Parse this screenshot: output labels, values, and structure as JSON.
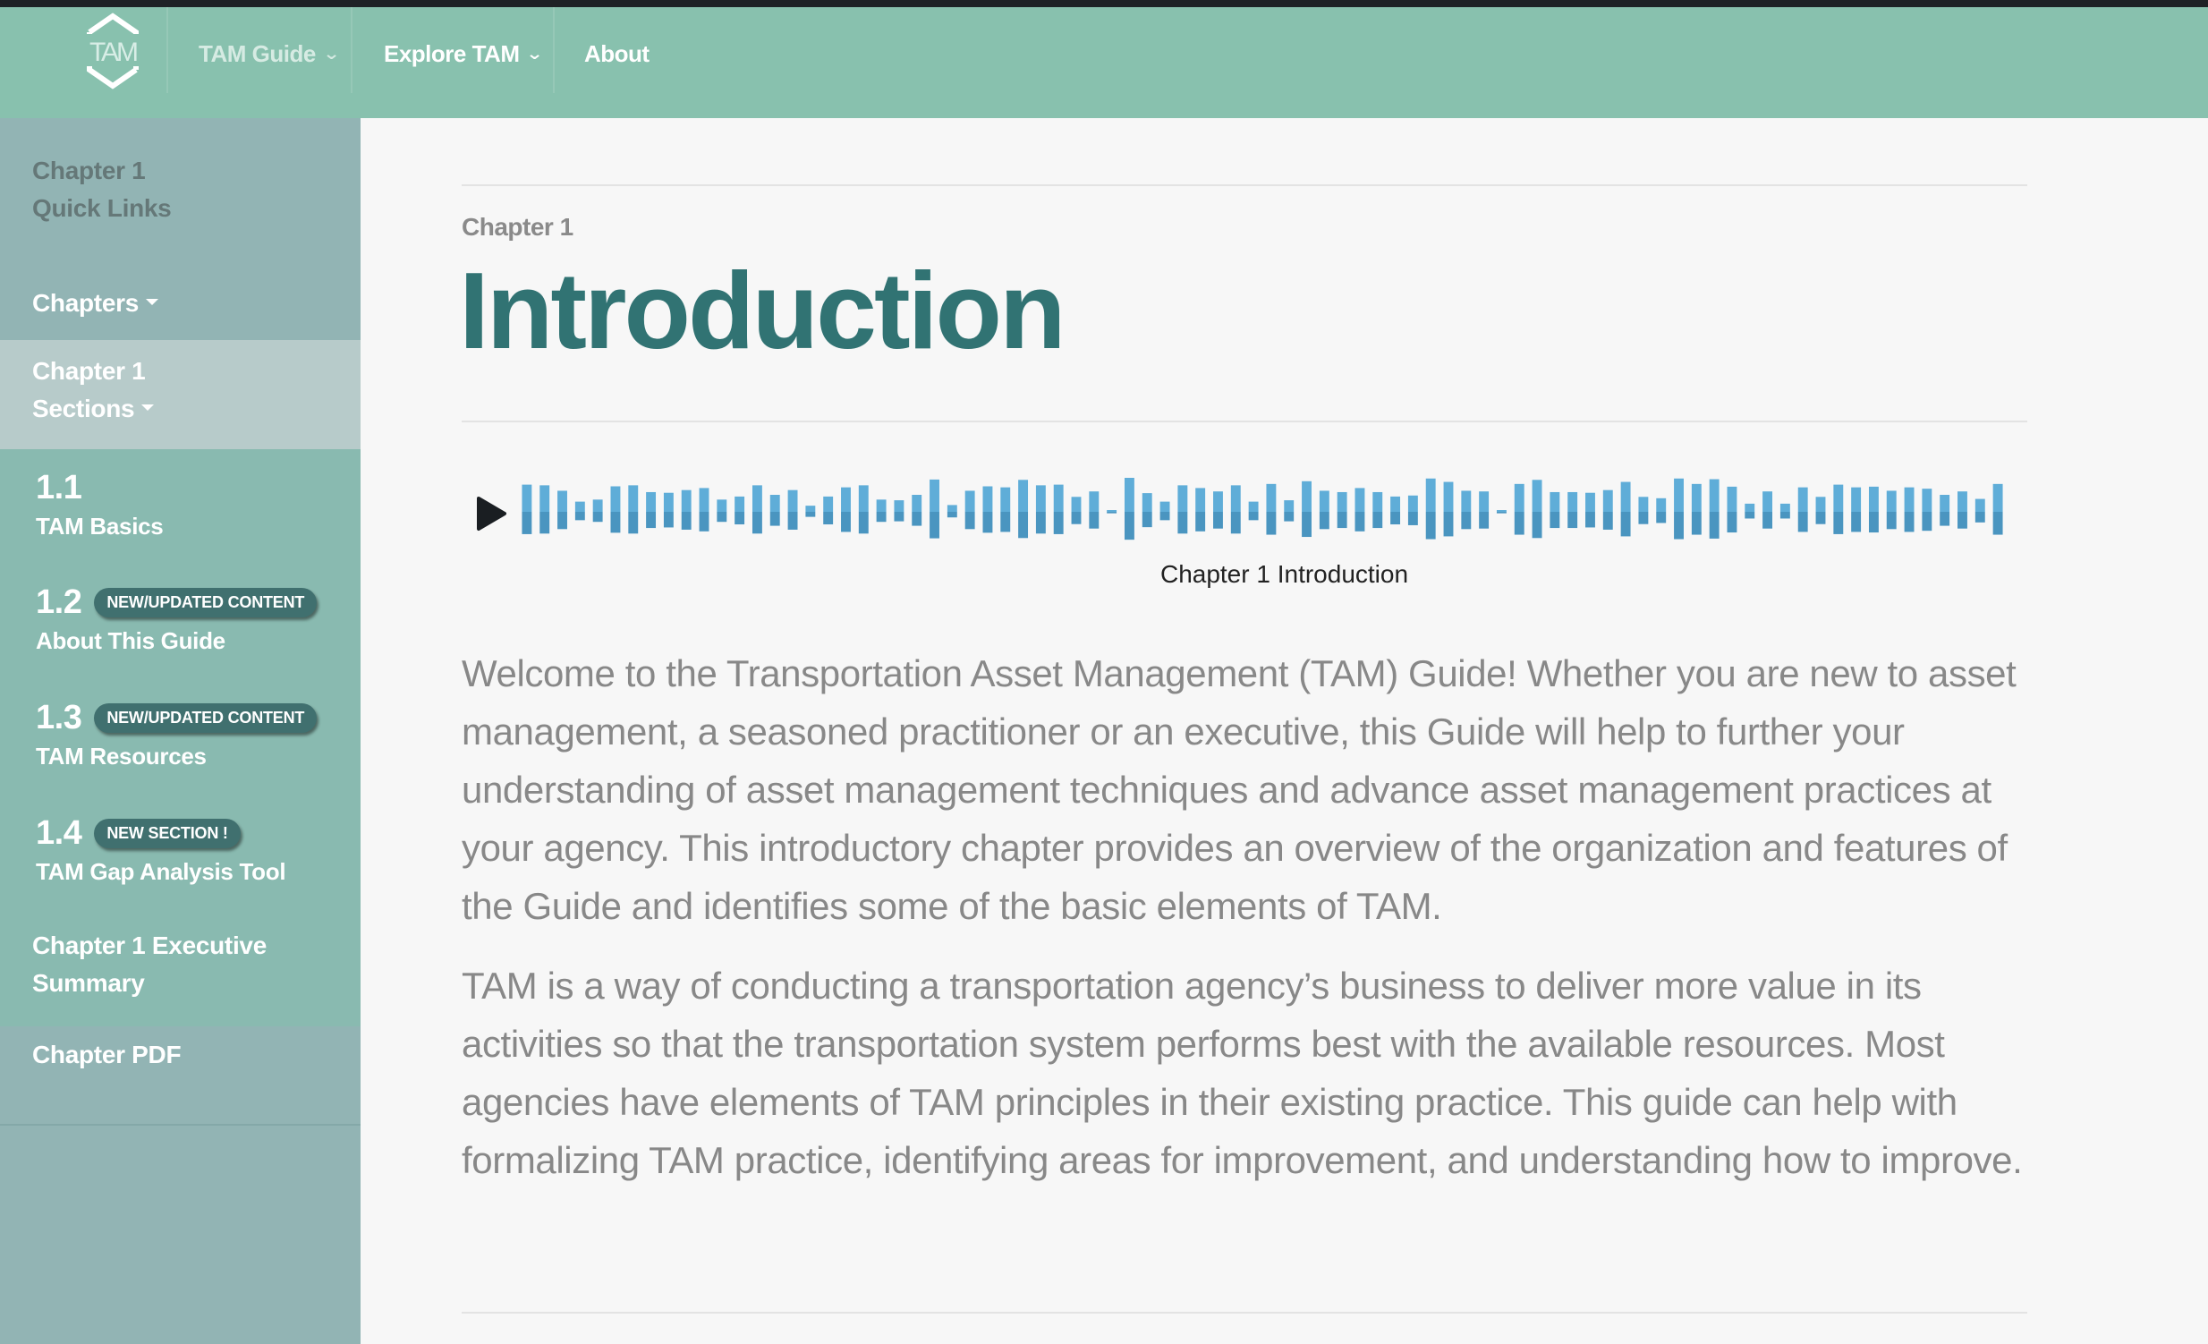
{
  "header": {
    "logo_text": "TAM",
    "nav": [
      {
        "label": "TAM Guide",
        "has_dropdown": true,
        "icon": "chevron-down-icon"
      },
      {
        "label": "Explore TAM",
        "has_dropdown": true,
        "icon": "chevron-down-icon"
      },
      {
        "label": "About",
        "has_dropdown": false
      }
    ]
  },
  "sidebar": {
    "quick_links_line1": "Chapter 1",
    "quick_links_line2": "Quick Links",
    "chapters_label": "Chapters",
    "sections_line1": "Chapter 1",
    "sections_line2": "Sections",
    "sections": [
      {
        "number": "1.1",
        "title": "TAM Basics",
        "badge": null
      },
      {
        "number": "1.2",
        "title": "About This Guide",
        "badge": "NEW/UPDATED CONTENT"
      },
      {
        "number": "1.3",
        "title": "TAM Resources",
        "badge": "NEW/UPDATED CONTENT"
      },
      {
        "number": "1.4",
        "title": "TAM Gap Analysis Tool",
        "badge": "NEW SECTION !"
      }
    ],
    "exec_summary_line1": "Chapter 1 Executive",
    "exec_summary_line2": "Summary",
    "pdf_label": "Chapter PDF"
  },
  "main": {
    "kicker": "Chapter 1",
    "title": "Introduction",
    "audio": {
      "caption": "Chapter 1 Introduction",
      "play_icon": "play-icon",
      "waveform_levels": [
        0.8,
        0.78,
        0.62,
        0.3,
        0.36,
        0.75,
        0.78,
        0.58,
        0.56,
        0.64,
        0.7,
        0.36,
        0.45,
        0.78,
        0.5,
        0.64,
        0.18,
        0.45,
        0.72,
        0.78,
        0.36,
        0.34,
        0.5,
        0.95,
        0.2,
        0.62,
        0.75,
        0.72,
        0.94,
        0.78,
        0.8,
        0.44,
        0.6,
        0.04,
        1.0,
        0.55,
        0.3,
        0.78,
        0.7,
        0.6,
        0.78,
        0.3,
        0.82,
        0.34,
        0.9,
        0.62,
        0.58,
        0.7,
        0.58,
        0.45,
        0.48,
        0.98,
        0.88,
        0.62,
        0.6,
        0.04,
        0.82,
        0.94,
        0.58,
        0.58,
        0.56,
        0.64,
        0.88,
        0.44,
        0.4,
        0.98,
        0.82,
        0.96,
        0.74,
        0.24,
        0.6,
        0.24,
        0.72,
        0.44,
        0.8,
        0.72,
        0.74,
        0.62,
        0.72,
        0.68,
        0.5,
        0.6,
        0.38,
        0.82
      ],
      "color_top": "#5fadd8",
      "color_bottom": "#4a95c0"
    },
    "paragraphs": [
      "Welcome to the Transportation Asset Management (TAM) Guide! Whether you are new to asset management, a seasoned practitioner or an executive, this Guide will help to further your understanding of asset management techniques and advance asset management practices at your agency. This introductory chapter provides an overview of the organization and features of the Guide and identifies some of the basic elements of TAM.",
      "TAM is a way of conducting a transportation agency’s business to deliver more value in its activities so that the transportation system performs best with the available resources. Most agencies have elements of TAM principles in their existing practice. This guide can help with formalizing TAM practice, identifying areas for improvement, and understanding how to improve."
    ]
  },
  "colors": {
    "navbar": "#88c1ae",
    "sidebar": "#92b4b4",
    "sidebar_active": "#b7cbca",
    "sidebar_sections": "#89bab0",
    "badge": "#40706f",
    "title": "#317373"
  }
}
